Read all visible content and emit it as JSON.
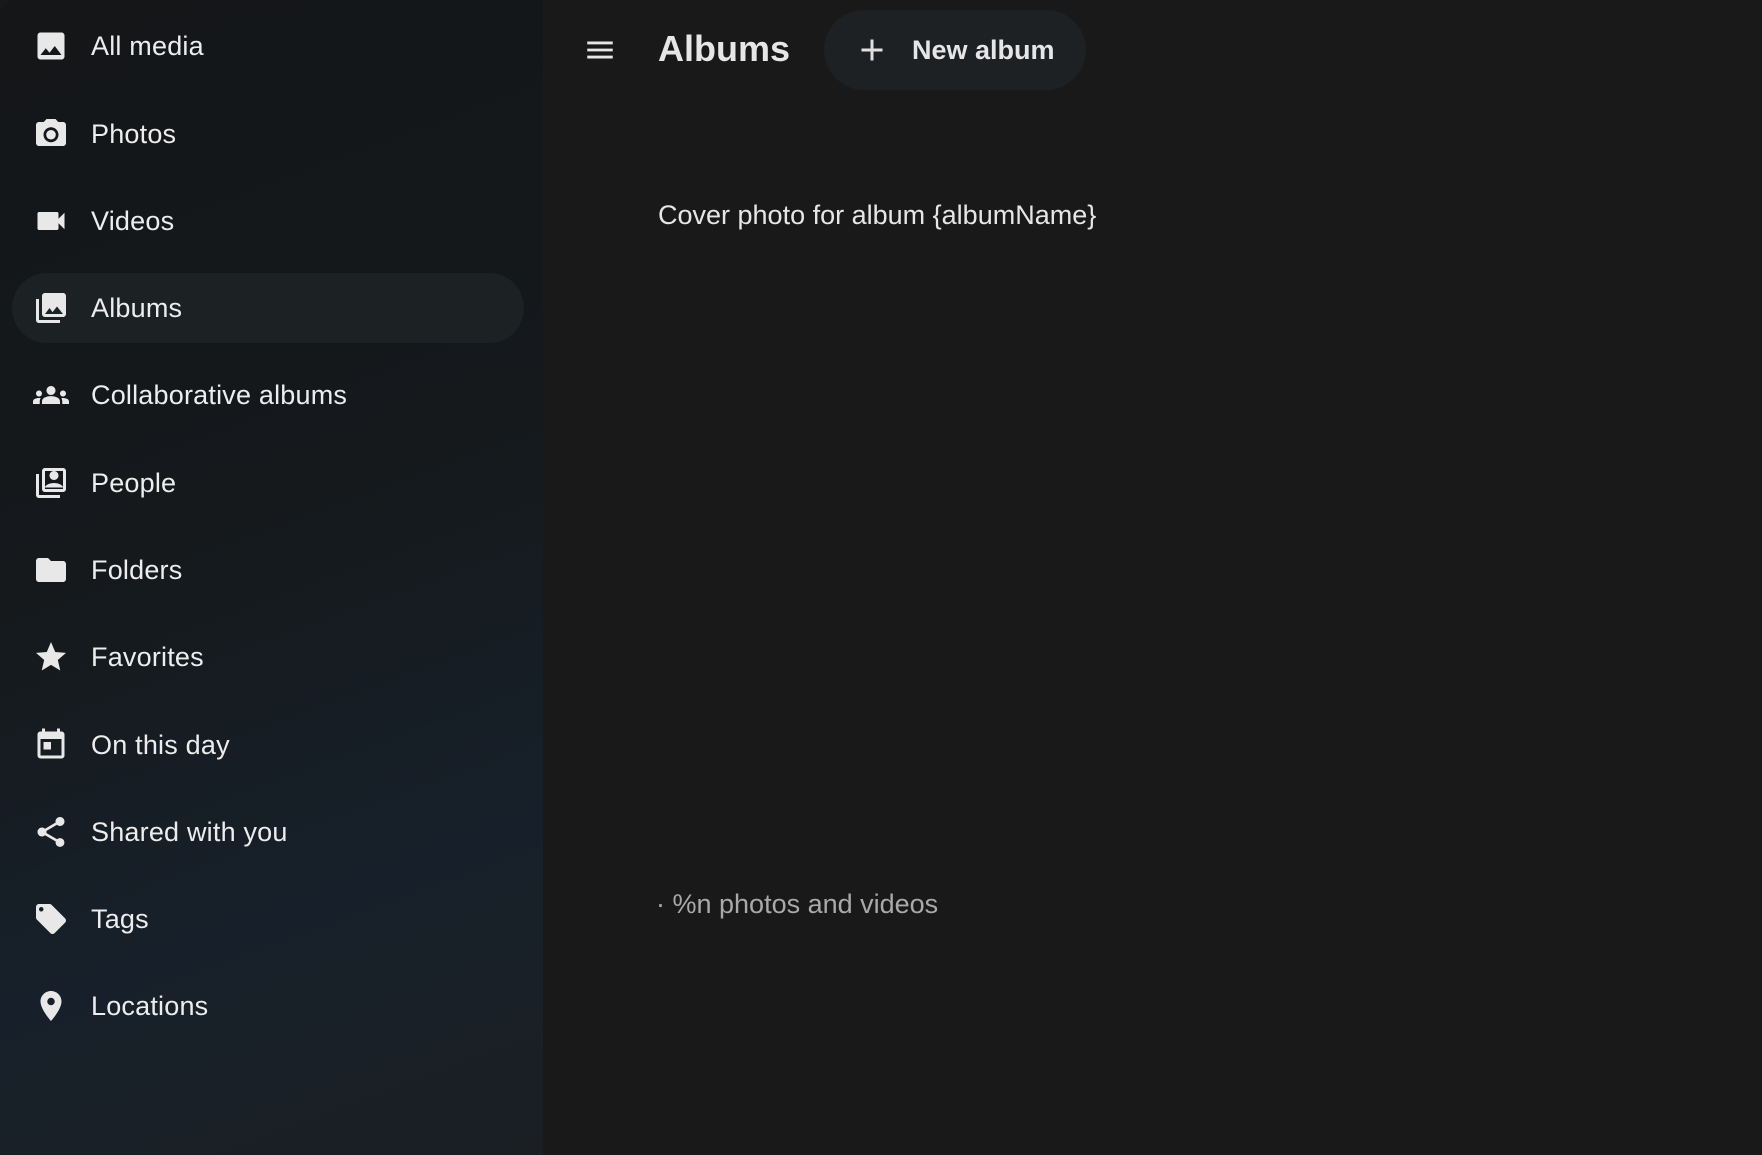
{
  "sidebar": {
    "items": [
      {
        "label": "All media",
        "icon": "image-icon",
        "active": false
      },
      {
        "label": "Photos",
        "icon": "camera-icon",
        "active": false
      },
      {
        "label": "Videos",
        "icon": "video-icon",
        "active": false
      },
      {
        "label": "Albums",
        "icon": "albums-icon",
        "active": true
      },
      {
        "label": "Collaborative albums",
        "icon": "group-icon",
        "active": false
      },
      {
        "label": "People",
        "icon": "people-icon",
        "active": false
      },
      {
        "label": "Folders",
        "icon": "folder-icon",
        "active": false
      },
      {
        "label": "Favorites",
        "icon": "star-icon",
        "active": false
      },
      {
        "label": "On this day",
        "icon": "calendar-icon",
        "active": false
      },
      {
        "label": "Shared with you",
        "icon": "share-icon",
        "active": false
      },
      {
        "label": "Tags",
        "icon": "tag-icon",
        "active": false
      },
      {
        "label": "Locations",
        "icon": "location-pin-icon",
        "active": false
      }
    ]
  },
  "header": {
    "menu_icon": "hamburger-menu-icon",
    "title": "Albums",
    "new_album_label": "New album",
    "new_album_icon": "plus-icon"
  },
  "album": {
    "cover_alt_text": "Cover photo for album {albumName}",
    "meta_text": "· %n photos and videos"
  },
  "colors": {
    "background": "#191919",
    "sidebar_active": "#1c2224",
    "button_bg": "#1d2123",
    "text_primary": "#e6e6e6",
    "text_secondary": "#a9a9a9"
  }
}
